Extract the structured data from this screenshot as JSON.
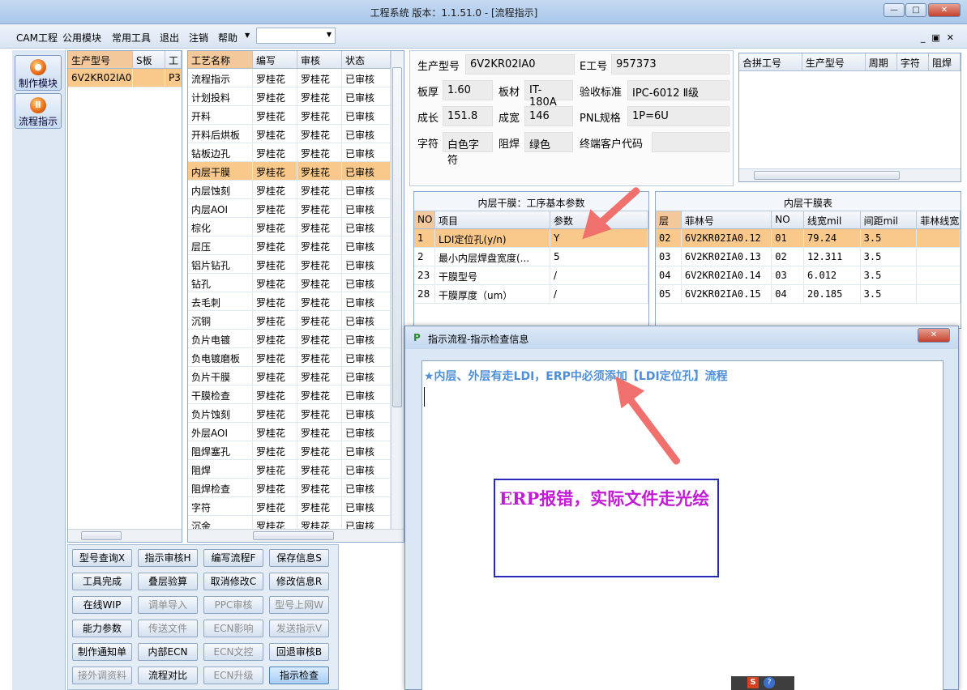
{
  "window": {
    "title": "工程系统   版本：1.1.51.0 - [流程指示]"
  },
  "menu": {
    "items": [
      "CAM工程",
      "公用模块",
      "常用工具",
      "退出",
      "注销",
      "帮助"
    ],
    "combo_value": ""
  },
  "leftnav": {
    "items": [
      {
        "label": "制作模块"
      },
      {
        "label": "流程指示"
      }
    ]
  },
  "models": {
    "headers": [
      "生产型号",
      "S板",
      "工"
    ],
    "rows": [
      [
        "6V2KR02IA0",
        "",
        "P3"
      ]
    ]
  },
  "process": {
    "headers": [
      "工艺名称",
      "编写",
      "审核",
      "状态"
    ],
    "selected_index": 5,
    "rows": [
      [
        "流程指示",
        "罗桂花",
        "罗桂花",
        "已审核"
      ],
      [
        "计划投料",
        "罗桂花",
        "罗桂花",
        "已审核"
      ],
      [
        "开料",
        "罗桂花",
        "罗桂花",
        "已审核"
      ],
      [
        "开料后烘板",
        "罗桂花",
        "罗桂花",
        "已审核"
      ],
      [
        "钻板边孔",
        "罗桂花",
        "罗桂花",
        "已审核"
      ],
      [
        "内层干膜",
        "罗桂花",
        "罗桂花",
        "已审核"
      ],
      [
        "内层蚀刻",
        "罗桂花",
        "罗桂花",
        "已审核"
      ],
      [
        "内层AOI",
        "罗桂花",
        "罗桂花",
        "已审核"
      ],
      [
        "棕化",
        "罗桂花",
        "罗桂花",
        "已审核"
      ],
      [
        "层压",
        "罗桂花",
        "罗桂花",
        "已审核"
      ],
      [
        "铝片钻孔",
        "罗桂花",
        "罗桂花",
        "已审核"
      ],
      [
        "钻孔",
        "罗桂花",
        "罗桂花",
        "已审核"
      ],
      [
        "去毛刺",
        "罗桂花",
        "罗桂花",
        "已审核"
      ],
      [
        "沉铜",
        "罗桂花",
        "罗桂花",
        "已审核"
      ],
      [
        "负片电镀",
        "罗桂花",
        "罗桂花",
        "已审核"
      ],
      [
        "负电镀磨板",
        "罗桂花",
        "罗桂花",
        "已审核"
      ],
      [
        "负片干膜",
        "罗桂花",
        "罗桂花",
        "已审核"
      ],
      [
        "干膜检查",
        "罗桂花",
        "罗桂花",
        "已审核"
      ],
      [
        "负片蚀刻",
        "罗桂花",
        "罗桂花",
        "已审核"
      ],
      [
        "外层AOI",
        "罗桂花",
        "罗桂花",
        "已审核"
      ],
      [
        "阻焊塞孔",
        "罗桂花",
        "罗桂花",
        "已审核"
      ],
      [
        "阻焊",
        "罗桂花",
        "罗桂花",
        "已审核"
      ],
      [
        "阻焊检查",
        "罗桂花",
        "罗桂花",
        "已审核"
      ],
      [
        "字符",
        "罗桂花",
        "罗桂花",
        "已审核"
      ],
      [
        "沉金",
        "罗桂花",
        "罗桂花",
        "已审核"
      ]
    ]
  },
  "info": {
    "production_model_label": "生产型号",
    "production_model": "6V2KR02IA0",
    "e_number_label": "E工号",
    "e_number": "957373",
    "thickness_label": "板厚",
    "thickness": "1.60",
    "material_label": "板材",
    "material": "IT-180A",
    "standard_label": "验收标准",
    "standard": "IPC-6012 Ⅱ级",
    "length_label": "成长",
    "length": "151.8",
    "width_label": "成宽",
    "width": "146",
    "pnl_label": "PNL规格",
    "pnl": "1P=6U",
    "char_label": "字符",
    "char": "白色字符",
    "mask_label": "阻焊",
    "mask": "绿色",
    "customer_code_label": "终端客户代码",
    "customer_code": ""
  },
  "combine": {
    "headers": [
      "合拼工号",
      "生产型号",
      "周期",
      "字符",
      "阻焊"
    ]
  },
  "params": {
    "title": "内层干膜：工序基本参数",
    "headers": [
      "NO",
      "项目",
      "参数"
    ],
    "rows": [
      [
        "1",
        "LDI定位孔(y/n)",
        "Y"
      ],
      [
        "2",
        "最小内层焊盘宽度(...",
        "5"
      ],
      [
        "23",
        "干膜型号",
        "/"
      ],
      [
        "28",
        "干膜厚度（um）",
        "/"
      ]
    ]
  },
  "films": {
    "title": "内层干膜表",
    "headers": [
      "层",
      "菲林号",
      "NO",
      "线宽mil",
      "间距mil",
      "菲林线宽"
    ],
    "rows": [
      [
        "02",
        "6V2KR02IA0.12",
        "01",
        "79.24",
        "3.5",
        ""
      ],
      [
        "03",
        "6V2KR02IA0.13",
        "02",
        "12.311",
        "3.5",
        ""
      ],
      [
        "04",
        "6V2KR02IA0.14",
        "03",
        "6.012",
        "3.5",
        ""
      ],
      [
        "05",
        "6V2KR02IA0.15",
        "04",
        "20.185",
        "3.5",
        ""
      ]
    ]
  },
  "buttons": [
    {
      "label": "型号查询X",
      "enabled": true
    },
    {
      "label": "指示审核H",
      "enabled": true
    },
    {
      "label": "编写流程F",
      "enabled": true
    },
    {
      "label": "保存信息S",
      "enabled": true
    },
    {
      "label": "工具完成",
      "enabled": true
    },
    {
      "label": "叠层验算",
      "enabled": true
    },
    {
      "label": "取消修改C",
      "enabled": true
    },
    {
      "label": "修改信息R",
      "enabled": true
    },
    {
      "label": "在线WIP",
      "enabled": true
    },
    {
      "label": "调单导入",
      "enabled": false
    },
    {
      "label": "PPC审核",
      "enabled": false
    },
    {
      "label": "型号上网W",
      "enabled": false
    },
    {
      "label": "能力参数",
      "enabled": true
    },
    {
      "label": "传送文件",
      "enabled": false
    },
    {
      "label": "ECN影响",
      "enabled": false
    },
    {
      "label": "发送指示V",
      "enabled": false
    },
    {
      "label": "制作通知单",
      "enabled": true
    },
    {
      "label": "内部ECN",
      "enabled": true
    },
    {
      "label": "ECN文控",
      "enabled": false
    },
    {
      "label": "回退审核B",
      "enabled": true
    },
    {
      "label": "接外调资料",
      "enabled": false
    },
    {
      "label": "流程对比",
      "enabled": true
    },
    {
      "label": "ECN升级",
      "enabled": false
    },
    {
      "label": "指示检查",
      "enabled": true
    }
  ],
  "dialog": {
    "title": "指示流程-指示检查信息",
    "message": "★内层、外层有走LDI，ERP中必须添加【LDI定位孔】流程",
    "annotation": "ERP报错，实际文件走光绘"
  },
  "colors": {
    "selected_row": "#f8c98a",
    "annotation": "#c21bd6",
    "message": "#4f8fd8",
    "arrow": "#f0706d"
  }
}
